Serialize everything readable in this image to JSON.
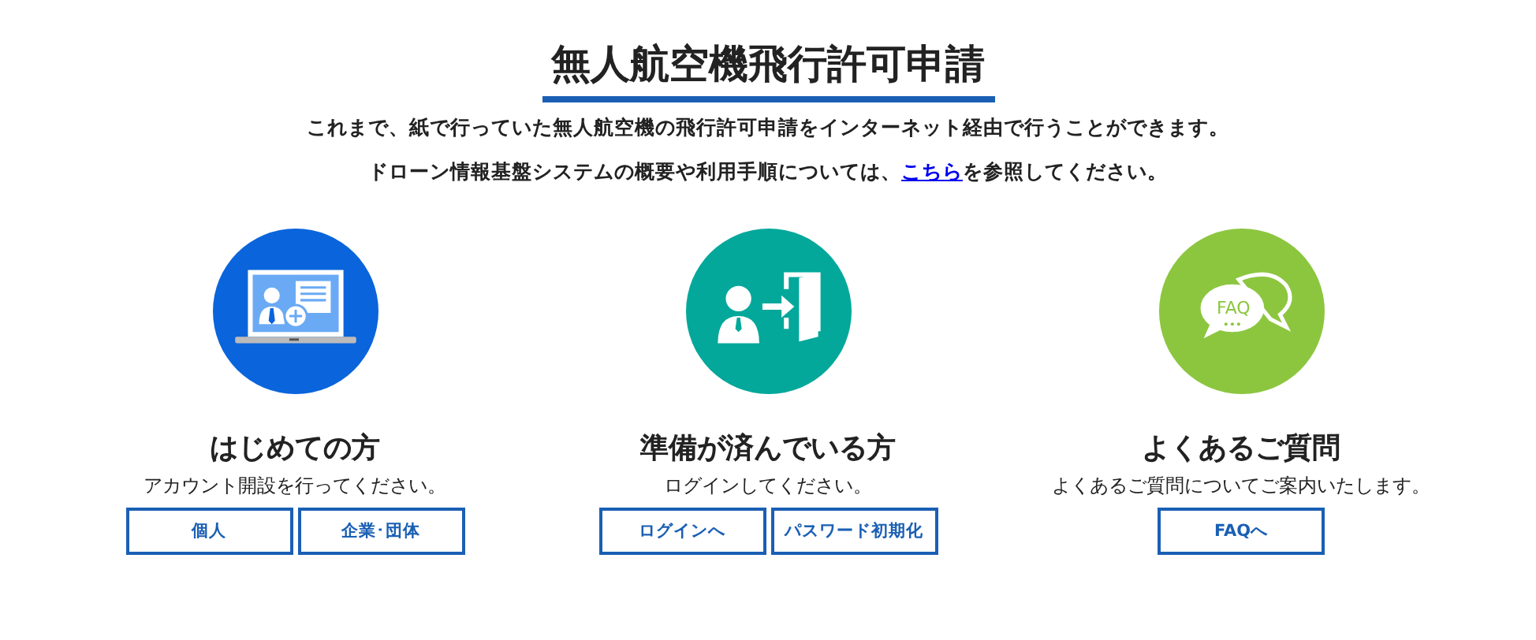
{
  "heading": "無人航空機飛行許可申請",
  "intro": "これまで、紙で行っていた無人航空機の飛行許可申請をインターネット経由で行うことができます。",
  "info": {
    "before": "ドローン情報基盤システムの概要や利用手順については、",
    "link": "こちら",
    "after": "を参照してください。"
  },
  "sections": [
    {
      "kind": "laptop",
      "color": "#0a64dc",
      "title": "はじめての方",
      "subtitle": "アカウント開設を行ってください。",
      "buttons": [
        "個人",
        "企業･団体"
      ]
    },
    {
      "kind": "login",
      "color": "#03a89b",
      "title": "準備が済んでいる方",
      "subtitle": "ログインしてください。",
      "buttons": [
        "ログインへ",
        "パスワード初期化"
      ]
    },
    {
      "kind": "faq",
      "color": "#8cc63f",
      "icon_text": "FAQ",
      "title": "よくあるご質問",
      "subtitle": "よくあるご質問についてご案内いたします。",
      "buttons": [
        "FAQへ"
      ]
    }
  ]
}
